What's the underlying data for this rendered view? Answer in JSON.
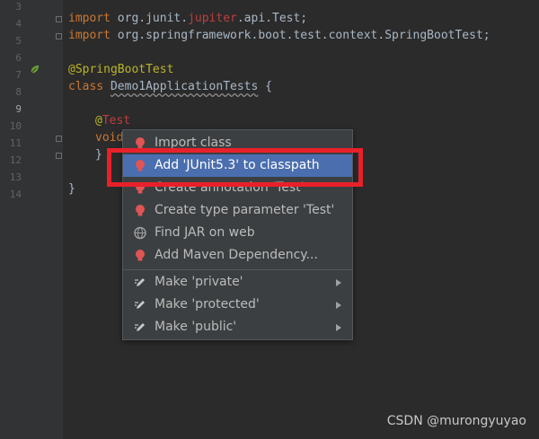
{
  "editor": {
    "line_numbers": [
      "3",
      "4",
      "5",
      "6",
      "7",
      "8",
      "9",
      "10",
      "11",
      "12",
      "13",
      "14"
    ],
    "lines": {
      "l3": {
        "kw": "import",
        "pre": " org.junit.",
        "err": "jupiter",
        "post": ".api.Test;"
      },
      "l4": {
        "kw": "import",
        "rest": " org.springframework.boot.test.context.SpringBootTest;"
      },
      "l6": {
        "annotation": "@SpringBootTest"
      },
      "l7": {
        "kw": "class",
        "name": "Demo1ApplicationTests",
        "brace": " {"
      },
      "l9": {
        "at": "@",
        "err": "Test"
      },
      "l10": {
        "kw": "void"
      },
      "l11": {
        "text": "}"
      },
      "l13": {
        "text": "}"
      }
    }
  },
  "popup": {
    "items": [
      {
        "label": "Import class",
        "icon": "bulb-icon"
      },
      {
        "label": "Add 'JUnit5.3' to classpath",
        "icon": "bulb-icon",
        "selected": true
      },
      {
        "label": "Create annotation 'Test'",
        "icon": "bulb-icon"
      },
      {
        "label": "Create type parameter 'Test'",
        "icon": "bulb-icon"
      },
      {
        "label": "Find JAR on web",
        "icon": "globe-icon"
      },
      {
        "label": "Add Maven Dependency...",
        "icon": "bulb-icon"
      },
      {
        "label": "Make 'private'",
        "icon": "pencil-icon",
        "submenu": true
      },
      {
        "label": "Make 'protected'",
        "icon": "pencil-icon",
        "submenu": true
      },
      {
        "label": "Make 'public'",
        "icon": "pencil-icon",
        "submenu": true
      }
    ]
  },
  "watermark": "CSDN @murongyuyao",
  "colors": {
    "background": "#2b2b2b",
    "gutter": "#313335",
    "selection": "#4b6eaf",
    "highlight_box": "#e8202a",
    "keyword": "#cc7832",
    "annotation": "#bbb529"
  }
}
